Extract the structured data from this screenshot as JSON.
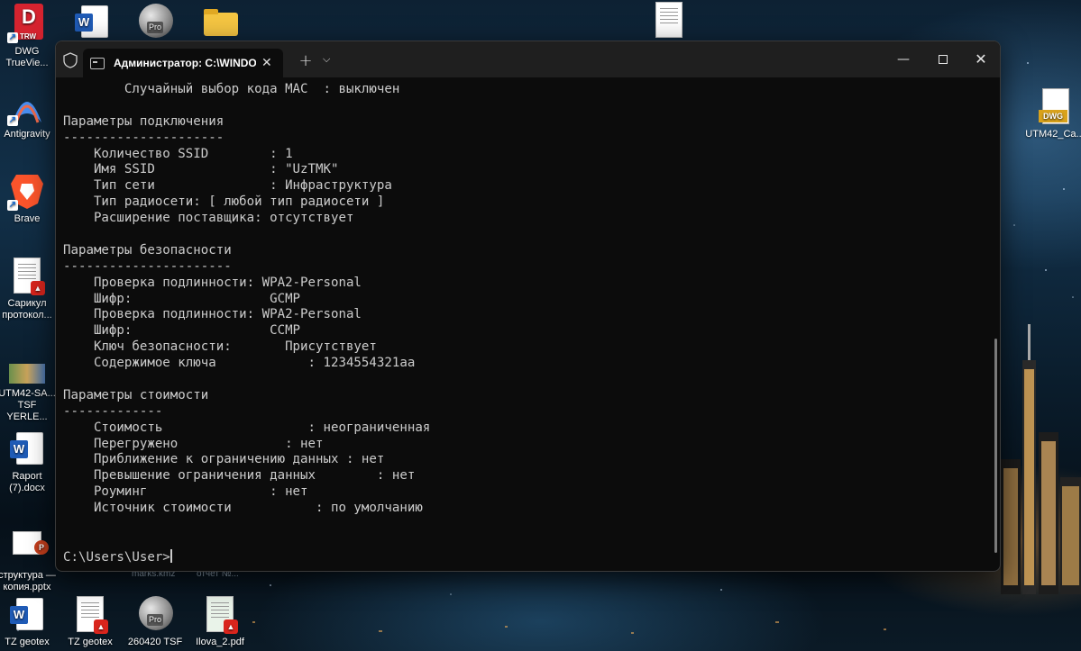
{
  "colors": {
    "terminal_bg": "#0c0c0c",
    "terminal_text": "#cccccc",
    "titlebar_bg": "#1f1f1f",
    "pdf_red": "#d9251d",
    "word_blue": "#1f5bb6",
    "dwg_red": "#d5232f"
  },
  "desktop": {
    "left_icons": [
      {
        "label": "DWG\nTrueVie...",
        "icon": "dwg-trueview-icon"
      },
      {
        "label": "Antigravity",
        "icon": "antigravity-icon"
      },
      {
        "label": "Brave",
        "icon": "brave-icon"
      },
      {
        "label": "Сарикул\nпротокол...",
        "icon": "pdf-document-icon"
      },
      {
        "label": "UTM42-SA...\nTSF YERLE...",
        "icon": "map-file-icon"
      },
      {
        "label": "Raport\n(7).docx",
        "icon": "word-document-icon"
      },
      {
        "label": "структура —\nкопия.pptx",
        "icon": "powerpoint-document-icon"
      }
    ],
    "bottom_icons": [
      {
        "label": "TZ geotex",
        "icon": "word-document-icon"
      },
      {
        "label": "TZ geotex",
        "icon": "pdf-document-icon"
      },
      {
        "label": "260420 TSF",
        "icon": "arcgis-pro-icon"
      },
      {
        "label": "Ilova_2.pdf",
        "icon": "pdf-document-icon"
      }
    ],
    "hidden_labels": [
      "marks.kmz",
      "отчет №..."
    ],
    "right_icons": [
      {
        "label": "UTM42_Ca...",
        "icon": "dwg-file-icon",
        "badge": "DWG"
      }
    ],
    "top_icons": [
      {
        "icon": "word-document-icon"
      },
      {
        "icon": "arcgis-pro-icon",
        "badge": "Pro"
      },
      {
        "icon": "folder-icon"
      },
      {
        "icon": "document-icon"
      }
    ],
    "trw_badge": "TRW",
    "dwg_letter": "D"
  },
  "terminal": {
    "tab_title": "Администратор: C:\\WINDOWS",
    "lines": [
      "        Случайный выбор кода MAC  : выключен",
      "",
      "Параметры подключения",
      "---------------------",
      "    Количество SSID        : 1",
      "    Имя SSID               : \"UzTMK\"",
      "    Тип сети               : Инфраструктура",
      "    Тип радиосети: [ любой тип радиосети ]",
      "    Расширение поставщика: отсутствует",
      "",
      "Параметры безопасности",
      "----------------------",
      "    Проверка подлинности: WPA2-Personal",
      "    Шифр:                  GCMP",
      "    Проверка подлинности: WPA2-Personal",
      "    Шифр:                  CCMP",
      "    Ключ безопасности:       Присутствует",
      "    Содержимое ключа            : 1234554321aa",
      "",
      "Параметры стоимости",
      "-------------",
      "    Стоимость                   : неограниченная",
      "    Перегружено              : нет",
      "    Приближение к ограничению данных : нет",
      "    Превышение ограничения данных        : нет",
      "    Роуминг                : нет",
      "    Источник стоимости           : по умолчанию"
    ],
    "prompt": "C:\\Users\\User>"
  }
}
